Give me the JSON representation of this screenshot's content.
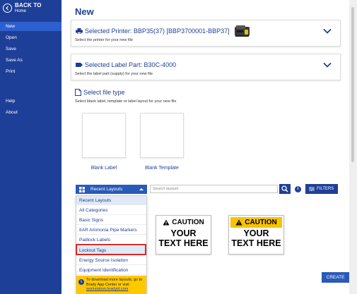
{
  "sidebar": {
    "back_title": "BACK TO",
    "back_sub": "Home",
    "items": [
      {
        "label": "New",
        "active": true
      },
      {
        "label": "Open"
      },
      {
        "label": "Save"
      },
      {
        "label": "Save As"
      },
      {
        "label": "Print"
      },
      {
        "label": "Help"
      },
      {
        "label": "About"
      }
    ]
  },
  "main": {
    "title": "New",
    "printer_card": {
      "title": "Selected Printer: BBP35(37) [BBP3700001-BBP37]",
      "subtitle": "Select the printer for your new file"
    },
    "label_card": {
      "title": "Selected Label Part: B30C-4000",
      "subtitle": "Select the label part (supply) for your new file"
    },
    "file_type": {
      "title": "Select file type",
      "subtitle": "Select blank label, template or label layout for your new file",
      "tiles": [
        {
          "label": "Blank Label"
        },
        {
          "label": "Blank Template"
        }
      ]
    },
    "category_button": "Recent Layouts",
    "search_placeholder": "Search layouts",
    "filters_label": "FILTERS",
    "info_glyph": "i",
    "dropdown": {
      "items": [
        {
          "label": "Recent Layouts",
          "selected": true
        },
        {
          "label": "All Categories"
        },
        {
          "label": "Basic Signs"
        },
        {
          "label": "IIAR Ammonia Pipe Markers"
        },
        {
          "label": "Padlock Labels"
        },
        {
          "label": "Lockout Tags",
          "selected": true
        },
        {
          "label": "Energy Source Isolation"
        },
        {
          "label": "Equipment Identification"
        }
      ],
      "footer_icon": "i",
      "footer_text": "To download more layouts, go to Brady App Center or visit",
      "footer_link": "workstation.bradyid.com"
    },
    "layouts": [
      {
        "header": "CAUTION",
        "body_line1": "YOUR",
        "body_line2": "TEXT HERE",
        "header_color": "#ffffff"
      },
      {
        "header": "CAUTION",
        "body_line1": "YOUR",
        "body_line2": "TEXT HERE",
        "header_color": "#f7c200"
      }
    ],
    "create_label": "CREATE"
  },
  "colors": {
    "brand": "#1e3f98",
    "accent": "#2a5ab8",
    "highlight": "#e0271f",
    "caution_yellow": "#f7c200"
  }
}
